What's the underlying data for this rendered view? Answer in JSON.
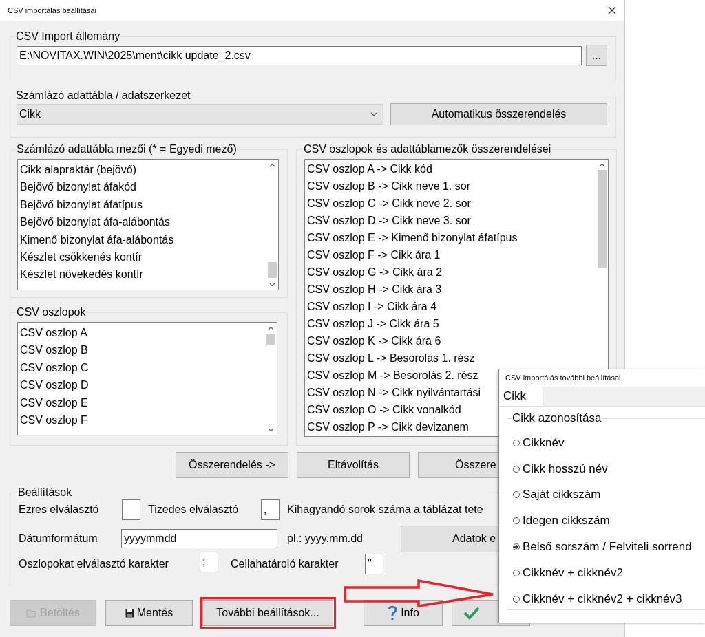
{
  "window": {
    "title": "CSV importálás beállításai"
  },
  "import_file": {
    "label": "CSV Import állomány",
    "value": "E:\\NOVITAX.WIN\\2025\\ment\\cikk update_2.csv",
    "browse_button": "..."
  },
  "data_table": {
    "label": "Számlázó adattábla / adatszerkezet",
    "value": "Cikk",
    "auto_button": "Automatikus összerendelés"
  },
  "table_fields": {
    "label": "Számlázó adattábla mezői (* = Egyedi mező)",
    "items": [
      "Cikk alapraktár (bejövő)",
      "Bejövő bizonylat áfakód",
      "Bejövő bizonylat áfatípus",
      "Bejövő bizonylat áfa-alábontás",
      "Kimenő bizonylat áfa-alábontás",
      "Készlet csökkenés kontír",
      "Készlet növekedés kontír"
    ]
  },
  "csv_columns": {
    "label": "CSV oszlopok",
    "items": [
      "CSV oszlop A",
      "CSV oszlop B",
      "CSV oszlop C",
      "CSV oszlop D",
      "CSV oszlop E",
      "CSV oszlop F"
    ]
  },
  "mappings": {
    "label": "CSV oszlopok és adattáblamezők összerendelései",
    "items": [
      "CSV oszlop A -> Cikk kód",
      "CSV oszlop B -> Cikk neve 1. sor",
      "CSV oszlop C -> Cikk neve 2. sor",
      "CSV oszlop D -> Cikk neve 3. sor",
      "CSV oszlop E -> Kimenő bizonylat áfatípus",
      "CSV oszlop F -> Cikk ára 1",
      "CSV oszlop G -> Cikk ára 2",
      "CSV oszlop H -> Cikk ára 3",
      "CSV oszlop I -> Cikk ára 4",
      "CSV oszlop J -> Cikk ára 5",
      "CSV oszlop K -> Cikk ára 6",
      "CSV oszlop L -> Besorolás 1. rész",
      "CSV oszlop M -> Besorolás 2. rész",
      "CSV oszlop N -> Cikk nyilvántartási",
      "CSV oszlop O -> Cikk vonalkód",
      "CSV oszlop P -> Cikk devizanem"
    ]
  },
  "mapping_buttons": [
    "Összerendelés ->",
    "Eltávolítás",
    "Összere"
  ],
  "settings": {
    "label": "Beállítások",
    "thousands_label": "Ezres elválasztó",
    "decimal_label": "Tizedes elválasztó",
    "decimal_value": ",",
    "skip_rows_label": "Kihagyandó sorok száma a táblázat tete",
    "date_label": "Dátumformátum",
    "date_value": "yyyymmdd",
    "date_example": "pl.: yyyy.mm.dd",
    "data_button": "Adatok e",
    "column_sep_label": "Oszlopokat elválasztó karakter",
    "column_sep_value": ";",
    "quote_label": "Cellahatároló karakter",
    "quote_value": "\""
  },
  "footer_buttons": [
    {
      "kind": "folder",
      "label": "Betöltés",
      "disabled": true,
      "highlighted": false
    },
    {
      "kind": "save",
      "label": "Mentés",
      "disabled": false,
      "highlighted": false
    },
    {
      "kind": "plain",
      "label": "További beállítások...",
      "disabled": false,
      "highlighted": true
    },
    {
      "kind": "help",
      "label": "Info",
      "disabled": false,
      "highlighted": false
    },
    {
      "kind": "check",
      "disabled": false,
      "highlighted": false
    }
  ],
  "more_settings": {
    "title": "CSV importálás további beállításai",
    "tabs": [
      {
        "label": "Cikk",
        "selected": true
      }
    ],
    "group_label": "Cikk azonosítása",
    "options": [
      {
        "label": "Cikknév",
        "selected": false
      },
      {
        "label": "Cikk hosszú név",
        "selected": false
      },
      {
        "label": "Saját cikkszám",
        "selected": false
      },
      {
        "label": "Idegen cikkszám",
        "selected": false
      },
      {
        "label": "Belső sorszám / Felviteli sorrend",
        "selected": true
      },
      {
        "label": "Cikknév + cikknév2",
        "selected": false
      },
      {
        "label": "Cikknév + cikknév2 + cikknév3",
        "selected": false
      }
    ]
  }
}
